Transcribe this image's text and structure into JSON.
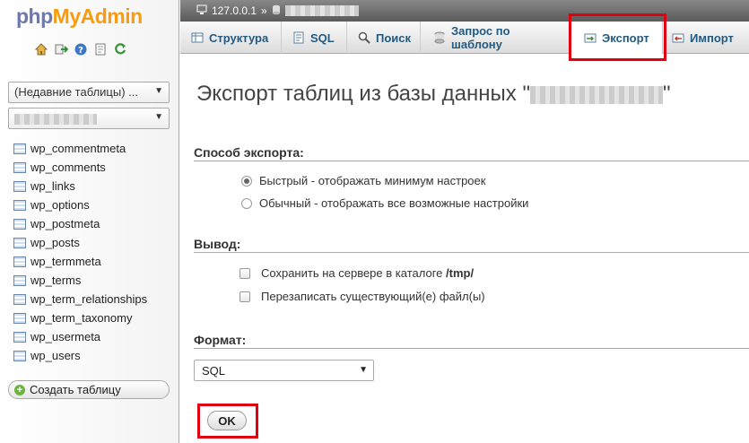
{
  "logo": {
    "part1": "php",
    "part2": "MyAdmin"
  },
  "left_panel": {
    "recent_tables_select": "(Недавние таблицы) ...",
    "tables": [
      "wp_commentmeta",
      "wp_comments",
      "wp_links",
      "wp_options",
      "wp_postmeta",
      "wp_posts",
      "wp_termmeta",
      "wp_terms",
      "wp_term_relationships",
      "wp_term_taxonomy",
      "wp_usermeta",
      "wp_users"
    ],
    "create_table_label": "Создать таблицу"
  },
  "breadcrumb": {
    "server": "127.0.0.1",
    "separator": "»"
  },
  "tabs": [
    {
      "label": "Структура",
      "icon": "structure-icon"
    },
    {
      "label": "SQL",
      "icon": "sql-icon"
    },
    {
      "label": "Поиск",
      "icon": "search-icon"
    },
    {
      "label": "Запрос по шаблону",
      "icon": "query-icon"
    },
    {
      "label": "Экспорт",
      "icon": "export-icon",
      "active": true
    },
    {
      "label": "Импорт",
      "icon": "import-icon"
    }
  ],
  "main": {
    "title_prefix": "Экспорт таблиц из базы данных \"",
    "title_suffix": "\"",
    "export_method_label": "Способ экспорта:",
    "export_options": [
      {
        "label": "Быстрый - отображать минимум настроек",
        "checked": true
      },
      {
        "label": "Обычный - отображать все возможные настройки",
        "checked": false
      }
    ],
    "output_label": "Вывод:",
    "save_on_server_label": "Сохранить на сервере в каталоге",
    "save_on_server_dir": "/tmp/",
    "overwrite_label": "Перезаписать существующий(е) файл(ы)",
    "format_label": "Формат:",
    "format_value": "SQL",
    "ok_label": "OK"
  },
  "colors": {
    "highlight": "#e0000f",
    "tab_text": "#235a81",
    "logo_blue": "#6c78af",
    "logo_orange": "#f89c0e"
  }
}
